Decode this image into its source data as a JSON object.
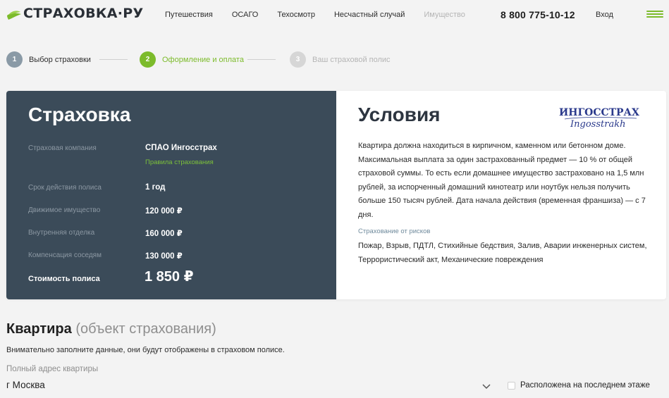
{
  "header": {
    "logo_text": "СТРАХОВКА·РУ",
    "nav": [
      {
        "label": "Путешествия",
        "disabled": false
      },
      {
        "label": "ОСАГО",
        "disabled": false
      },
      {
        "label": "Техосмотр",
        "disabled": false
      },
      {
        "label": "Несчастный случай",
        "disabled": false
      },
      {
        "label": "Имущество",
        "disabled": true
      }
    ],
    "phone": "8 800 775-10-12",
    "login": "Вход",
    "menu_icon": "burger-icon"
  },
  "steps": [
    {
      "num": "1",
      "label": "Выбор страховки",
      "state": "done"
    },
    {
      "num": "2",
      "label": "Оформление и оплата",
      "state": "active"
    },
    {
      "num": "3",
      "label": "Ваш страховой полис",
      "state": "pending"
    }
  ],
  "insurance": {
    "title": "Страховка",
    "company_label": "Страховая компания",
    "company_value": "СПАО Ингосстрах",
    "rules_link": "Правила страхования",
    "rows": [
      {
        "label": "Срок действия полиса",
        "value": "1 год"
      },
      {
        "label": "Движимое имущество",
        "value": "120 000 ₽"
      },
      {
        "label": "Внутренняя отделка",
        "value": "160 000 ₽"
      },
      {
        "label": "Компенсация соседям",
        "value": "130 000 ₽"
      }
    ],
    "total_label": "Стоимость полиса",
    "total_value": "1 850 ₽"
  },
  "conditions": {
    "title": "Условия",
    "insurer_logo_text": "ИНГОССТРАХ",
    "insurer_logo_script": "Ingosstrakh",
    "text": "Квартира должна находиться в кирпичном, каменном или бетонном доме. Максимальная выплата за один застрахованный предмет — 10 % от общей страховой суммы. То есть если домашнее имущество застраховано на 1,5 млн рублей, за испорченный домашний кинотеатр или ноутбук нельзя получить больше 150 тысяч рублей. Дата начала действия (временная франшиза) — с 7 дня.",
    "risks_title": "Страхование от рисков",
    "risks_text": "Пожар, Взрыв, ПДТЛ, Стихийные бедствия, Залив, Аварии инженерных систем, Террористический акт, Механические повреждения"
  },
  "apartment": {
    "title": "Квартира",
    "title_note": "(объект страхования)",
    "description": "Внимательно заполните данные, они будут отображены в страховом полисе.",
    "address_label": "Полный адрес квартиры",
    "address_value": "г Москва",
    "last_floor_label": "Расположена на последнем этаже",
    "last_floor_checked": false
  },
  "colors": {
    "accent_green": "#7cbb2b",
    "card_dark": "#3b4b59",
    "step_done": "#8a9aa6",
    "step_pending": "#d6d6d6"
  }
}
